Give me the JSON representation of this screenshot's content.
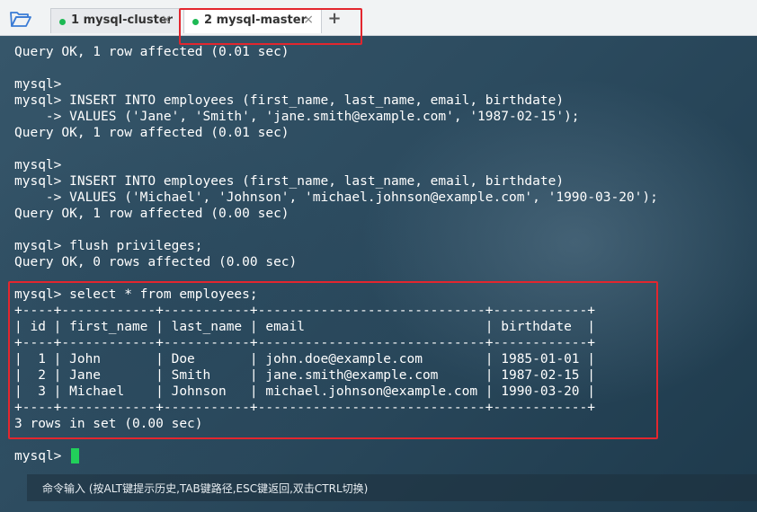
{
  "tabs": [
    {
      "label": "1 mysql-cluster",
      "status_color": "#1db954",
      "close": "×"
    },
    {
      "label": "2 mysql-master",
      "status_color": "#1db954",
      "close": "×",
      "active": true
    }
  ],
  "add_tab": "+",
  "highlight_color": "#e3262e",
  "terminal_lines": [
    "Query OK, 1 row affected (0.01 sec)",
    "",
    "mysql>",
    "mysql> INSERT INTO employees (first_name, last_name, email, birthdate)",
    "    -> VALUES ('Jane', 'Smith', 'jane.smith@example.com', '1987-02-15');",
    "Query OK, 1 row affected (0.01 sec)",
    "",
    "mysql>",
    "mysql> INSERT INTO employees (first_name, last_name, email, birthdate)",
    "    -> VALUES ('Michael', 'Johnson', 'michael.johnson@example.com', '1990-03-20');",
    "Query OK, 1 row affected (0.00 sec)",
    "",
    "mysql> flush privileges;",
    "Query OK, 0 rows affected (0.00 sec)",
    "",
    "mysql> select * from employees;",
    "+----+------------+-----------+-----------------------------+------------+",
    "| id | first_name | last_name | email                       | birthdate  |",
    "+----+------------+-----------+-----------------------------+------------+",
    "|  1 | John       | Doe       | john.doe@example.com        | 1985-01-01 |",
    "|  2 | Jane       | Smith     | jane.smith@example.com      | 1987-02-15 |",
    "|  3 | Michael    | Johnson   | michael.johnson@example.com | 1990-03-20 |",
    "+----+------------+-----------+-----------------------------+------------+",
    "3 rows in set (0.00 sec)",
    "",
    "mysql> "
  ],
  "cursor_color": "#21d05a",
  "command_bar": {
    "hint": "命令输入 (按ALT键提示历史,TAB键路径,ESC键返回,双击CTRL切换)"
  }
}
